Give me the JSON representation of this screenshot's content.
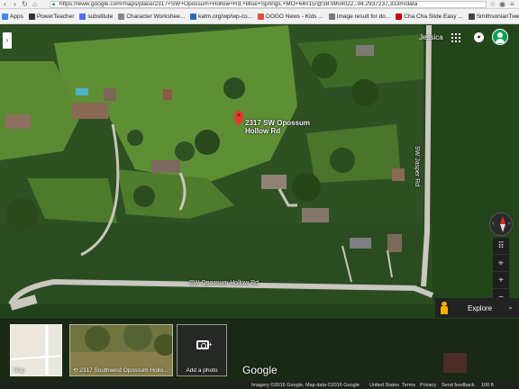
{
  "browser": {
    "url": "https://www.google.com/maps/place/2317+SW+Opossum+Hollow+Rd,+Blue+Springs,+MO+64015/@38.9959022,-94.2937237,333m/data",
    "bookmarks": [
      {
        "label": "Apps",
        "color": "#4285f4"
      },
      {
        "label": "PowerTeacher",
        "color": "#333333"
      },
      {
        "label": "substitute",
        "color": "#4c6ef5"
      },
      {
        "label": "Character Workshee...",
        "color": "#888888"
      },
      {
        "label": "katm.org/wp/wp-co...",
        "color": "#2b6cb0"
      },
      {
        "label": "DOGO News - Kids ...",
        "color": "#e74c3c"
      },
      {
        "label": "Image result for do...",
        "color": "#777777"
      },
      {
        "label": "Cha Cha Slide Easy ...",
        "color": "#cc0000"
      },
      {
        "label": "SmithsonianTweenT...",
        "color": "#444444"
      }
    ]
  },
  "header": {
    "user_name": "Jessica"
  },
  "map": {
    "pin_label": "2317 SW Opossum Hollow Rd",
    "road_vertical": "SW Jasper Rd",
    "road_horizontal": "SW Opossum Hollow Rd"
  },
  "controls": {
    "explore_label": "Explore"
  },
  "cards": {
    "map_label": "Map",
    "photo_label": "2317 Southwest Opossum Hollo...",
    "add_photo_label": "Add a photo"
  },
  "brand": "Google",
  "footer": {
    "imagery": "Imagery ©2016 Google, Map data ©2016 Google",
    "united_states": "United States",
    "terms": "Terms",
    "privacy": "Privacy",
    "feedback": "Send feedback",
    "scale": "100 ft"
  },
  "colors": {
    "pin": "#e53935",
    "avatar": "#0f9d58"
  }
}
